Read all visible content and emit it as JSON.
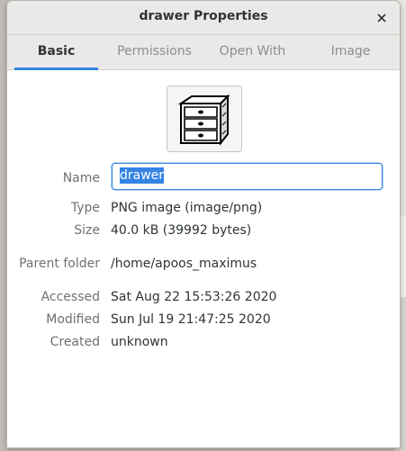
{
  "window": {
    "title": "drawer Properties",
    "close_icon": "close-icon"
  },
  "tabs": [
    {
      "label": "Basic",
      "active": true
    },
    {
      "label": "Permissions",
      "active": false
    },
    {
      "label": "Open With",
      "active": false
    },
    {
      "label": "Image",
      "active": false
    }
  ],
  "file_icon": "drawer-icon",
  "fields": {
    "name": {
      "label": "Name",
      "value": "drawer"
    },
    "type": {
      "label": "Type",
      "value": "PNG image (image/png)"
    },
    "size": {
      "label": "Size",
      "value": "40.0 kB (39992 bytes)"
    },
    "parent": {
      "label": "Parent folder",
      "value": "/home/apoos_maximus"
    },
    "accessed": {
      "label": "Accessed",
      "value": "Sat Aug 22 15:53:26 2020"
    },
    "modified": {
      "label": "Modified",
      "value": "Sun Jul 19 21:47:25 2020"
    },
    "created": {
      "label": "Created",
      "value": "unknown"
    }
  },
  "colors": {
    "accent": "#3584e4",
    "headerbar": "#ebe9e7"
  }
}
